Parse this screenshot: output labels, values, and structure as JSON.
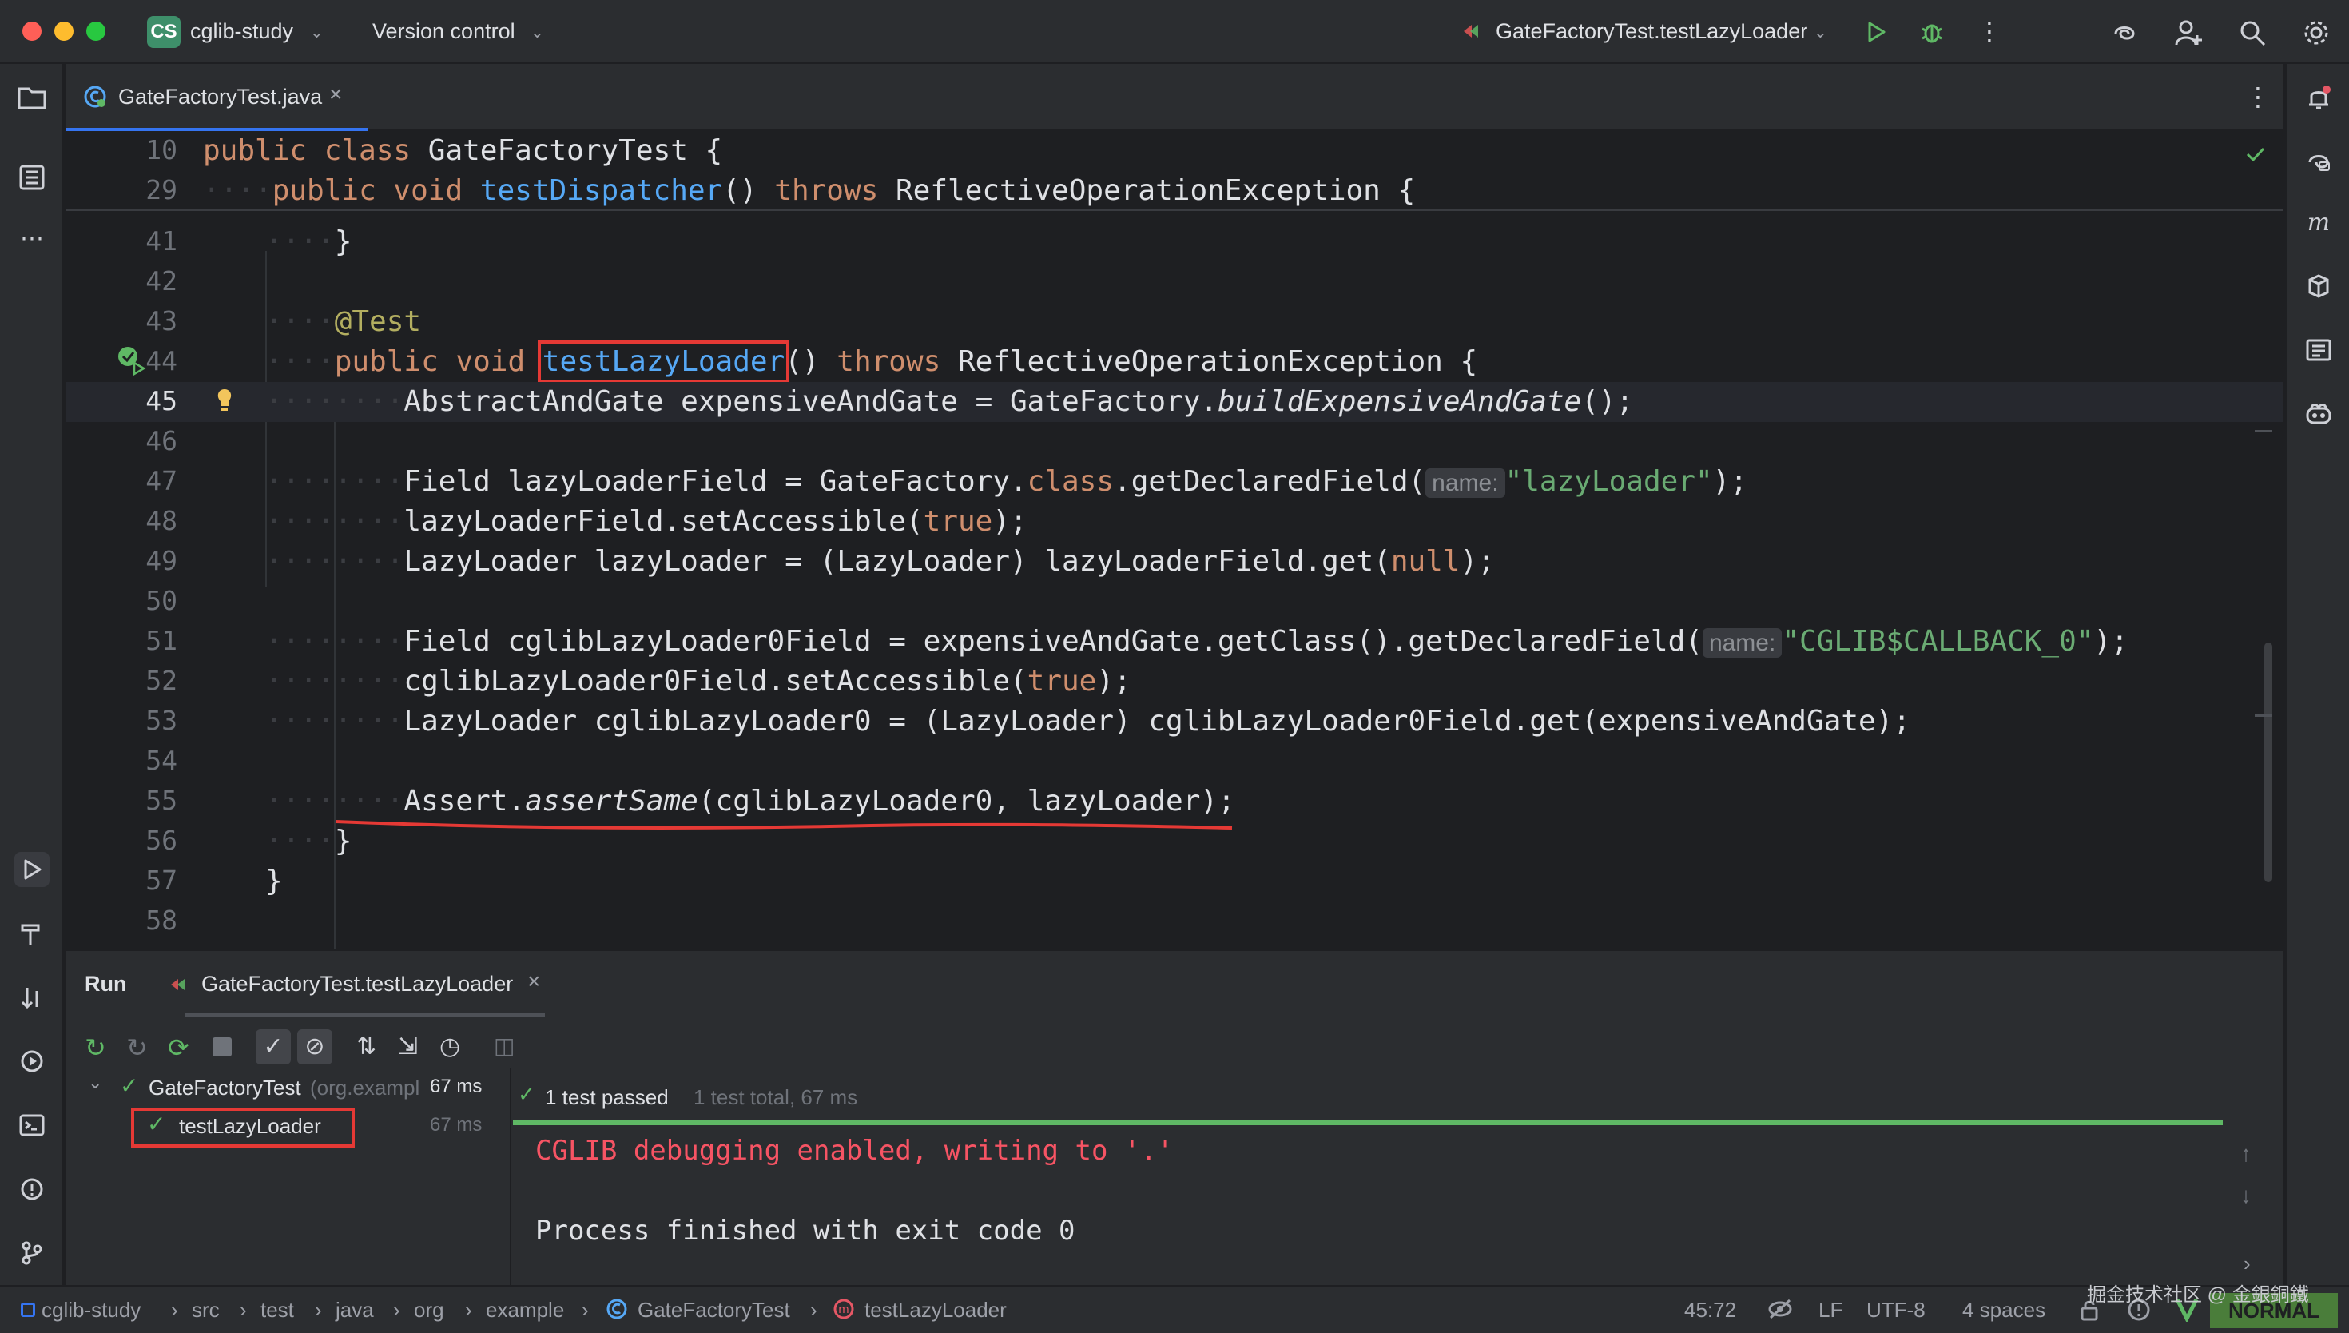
{
  "titlebar": {
    "project_badge": "CS",
    "project_name": "cglib-study",
    "version_control": "Version control",
    "run_config": "GateFactoryTest.testLazyLoader"
  },
  "tabs": [
    {
      "label": "GateFactoryTest.java",
      "active": true
    }
  ],
  "editor": {
    "sticky": [
      {
        "num": "10",
        "code": "public class GateFactoryTest {"
      },
      {
        "num": "29",
        "code": "public void testDispatcher() throws ReflectiveOperationException {"
      }
    ],
    "lines": [
      {
        "num": "41",
        "code": "}"
      },
      {
        "num": "42",
        "code": ""
      },
      {
        "num": "43",
        "code": "@Test"
      },
      {
        "num": "44",
        "code": "public void testLazyLoader() throws ReflectiveOperationException {"
      },
      {
        "num": "45",
        "code": "AbstractAndGate expensiveAndGate = GateFactory.buildExpensiveAndGate();"
      },
      {
        "num": "46",
        "code": ""
      },
      {
        "num": "47",
        "code": "Field lazyLoaderField = GateFactory.class.getDeclaredField(name: \"lazyLoader\");"
      },
      {
        "num": "48",
        "code": "lazyLoaderField.setAccessible(true);"
      },
      {
        "num": "49",
        "code": "LazyLoader lazyLoader = (LazyLoader) lazyLoaderField.get(null);"
      },
      {
        "num": "50",
        "code": ""
      },
      {
        "num": "51",
        "code": "Field cglibLazyLoader0Field = expensiveAndGate.getClass().getDeclaredField(name: \"CGLIB$CALLBACK_0\");"
      },
      {
        "num": "52",
        "code": "cglibLazyLoader0Field.setAccessible(true);"
      },
      {
        "num": "53",
        "code": "LazyLoader cglibLazyLoader0 = (LazyLoader) cglibLazyLoader0Field.get(expensiveAndGate);"
      },
      {
        "num": "54",
        "code": ""
      },
      {
        "num": "55",
        "code": "Assert.assertSame(cglibLazyLoader0, lazyLoader);"
      },
      {
        "num": "56",
        "code": "}"
      },
      {
        "num": "57",
        "code": "}"
      },
      {
        "num": "58",
        "code": ""
      }
    ],
    "param_hint": "name:"
  },
  "run": {
    "tab_run": "Run",
    "tab_config": "GateFactoryTest.testLazyLoader",
    "tree_root": "GateFactoryTest",
    "tree_root_pkg": "(org.exampl",
    "tree_root_time": "67 ms",
    "tree_child": "testLazyLoader",
    "tree_child_time": "67 ms",
    "summary_passed": "1 test passed",
    "summary_total": "1 test total, 67 ms",
    "console_line1": "CGLIB debugging enabled, writing to '.'",
    "console_line2": "Process finished with exit code 0"
  },
  "statusbar": {
    "breadcrumb": [
      "cglib-study",
      "src",
      "test",
      "java",
      "org",
      "example",
      "GateFactoryTest",
      "testLazyLoader"
    ],
    "position": "45:72",
    "line_sep": "LF",
    "encoding": "UTF-8",
    "indent": "4 spaces",
    "mode": "NORMAL",
    "watermark": "掘金技术社区 @ 金銀銅鐵"
  },
  "colors": {
    "accent": "#3574f0",
    "keyword": "#cf8e6d",
    "function": "#56a8f5",
    "string": "#6aab73",
    "annotation": "#b3ae60",
    "error_console": "#f75464",
    "success": "#5fb865",
    "highlight_box": "#e53935"
  }
}
